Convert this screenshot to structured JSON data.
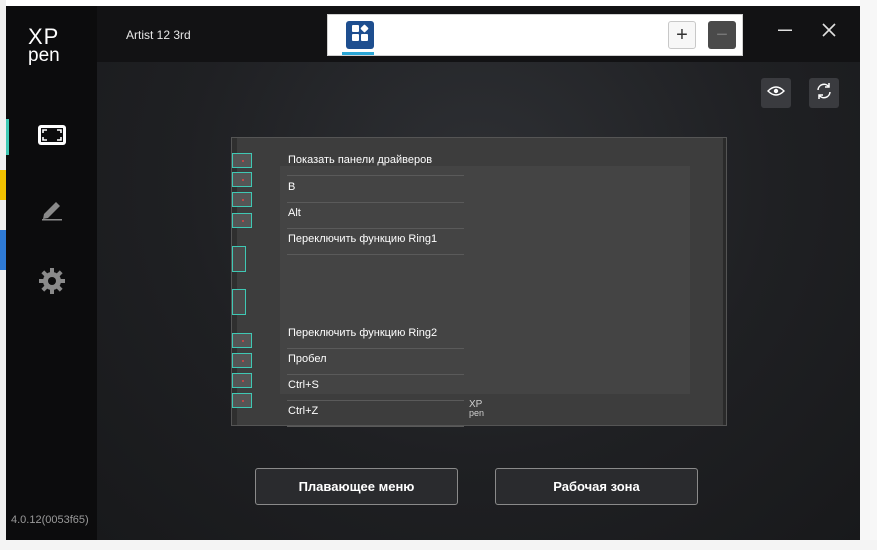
{
  "app": {
    "logo_line1": "XP",
    "logo_line2": "pen",
    "version": "4.0.12(0053f65)",
    "accent_color": "#3fc8b4"
  },
  "sidebar": {
    "items": [
      {
        "icon": "screen-area-icon",
        "active": true
      },
      {
        "icon": "pen-icon",
        "active": false
      },
      {
        "icon": "gear-icon",
        "active": false
      }
    ]
  },
  "header": {
    "device_name": "Artist 12 3rd",
    "app_tab_icon": "apps-grid-icon",
    "add_button": "+",
    "remove_button": "−"
  },
  "window_controls": {
    "minimize_icon": "minimize-icon",
    "close_icon": "close-icon"
  },
  "toolbar": {
    "view_icon": "eye-icon",
    "refresh_icon": "refresh-icon"
  },
  "tablet": {
    "logo_line1": "XP",
    "logo_line2": "pen",
    "keys": [
      {
        "label": "Показать панели драйверов"
      },
      {
        "label": "B"
      },
      {
        "label": "Alt"
      },
      {
        "label": "Переключить функцию Ring1"
      },
      {
        "label": "Переключить функцию Ring2"
      },
      {
        "label": "Пробел"
      },
      {
        "label": "Ctrl+S"
      },
      {
        "label": "Ctrl+Z"
      }
    ]
  },
  "buttons": {
    "floating_menu": "Плавающее меню",
    "work_area": "Рабочая зона"
  }
}
